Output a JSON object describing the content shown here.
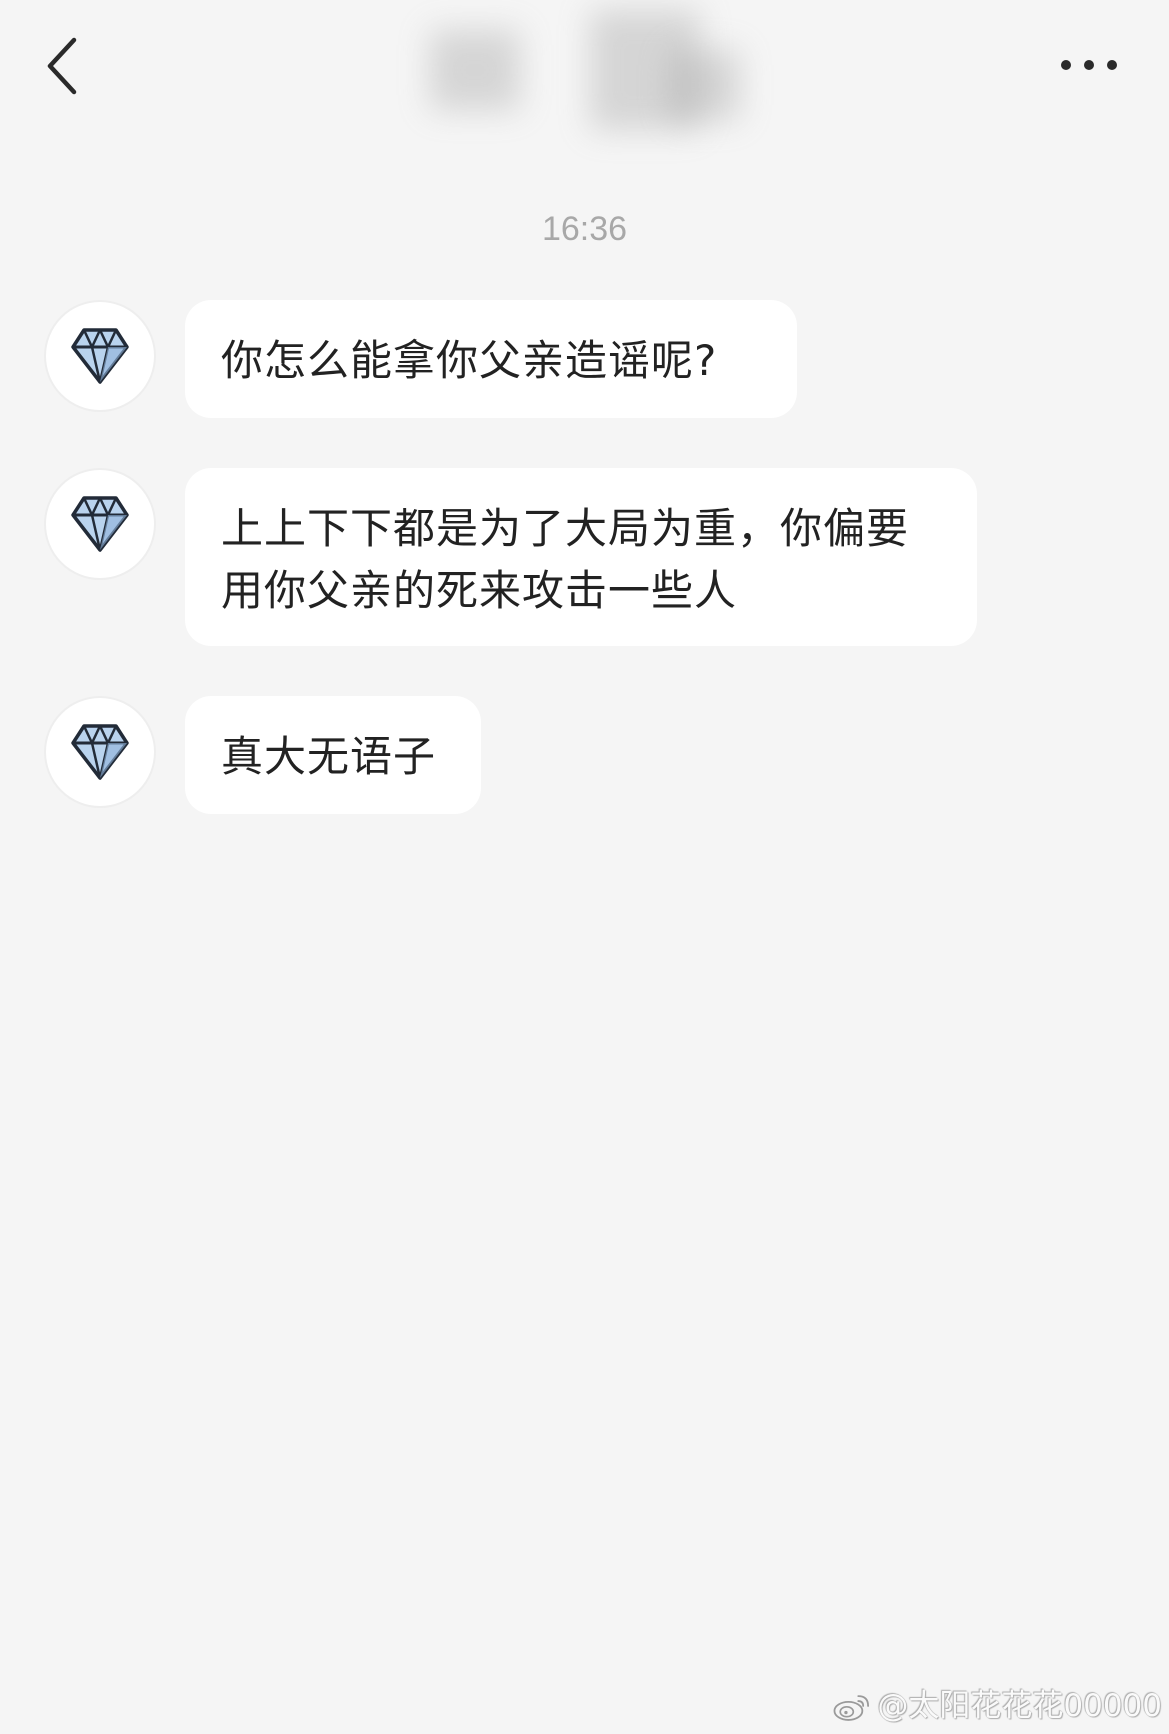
{
  "header": {
    "back_icon": "chevron-left-icon",
    "more_icon": "more-horizontal-icon"
  },
  "timestamp": "16:36",
  "messages": [
    {
      "text": "你怎么能拿你父亲造谣呢?",
      "avatar_icon": "diamond-icon"
    },
    {
      "text": "上上下下都是为了大局为重，你偏要用你父亲的死来攻击一些人",
      "avatar_icon": "diamond-icon"
    },
    {
      "text": "真大无语子",
      "avatar_icon": "diamond-icon"
    }
  ],
  "watermark": {
    "logo": "weibo-logo",
    "text": "@太阳花花花00000"
  },
  "colors": {
    "background": "#f5f5f5",
    "bubble": "#ffffff",
    "text": "#222222",
    "timestamp": "#a8a8a8",
    "diamond_fill": "#b9d3ee",
    "diamond_stroke": "#222b38"
  }
}
